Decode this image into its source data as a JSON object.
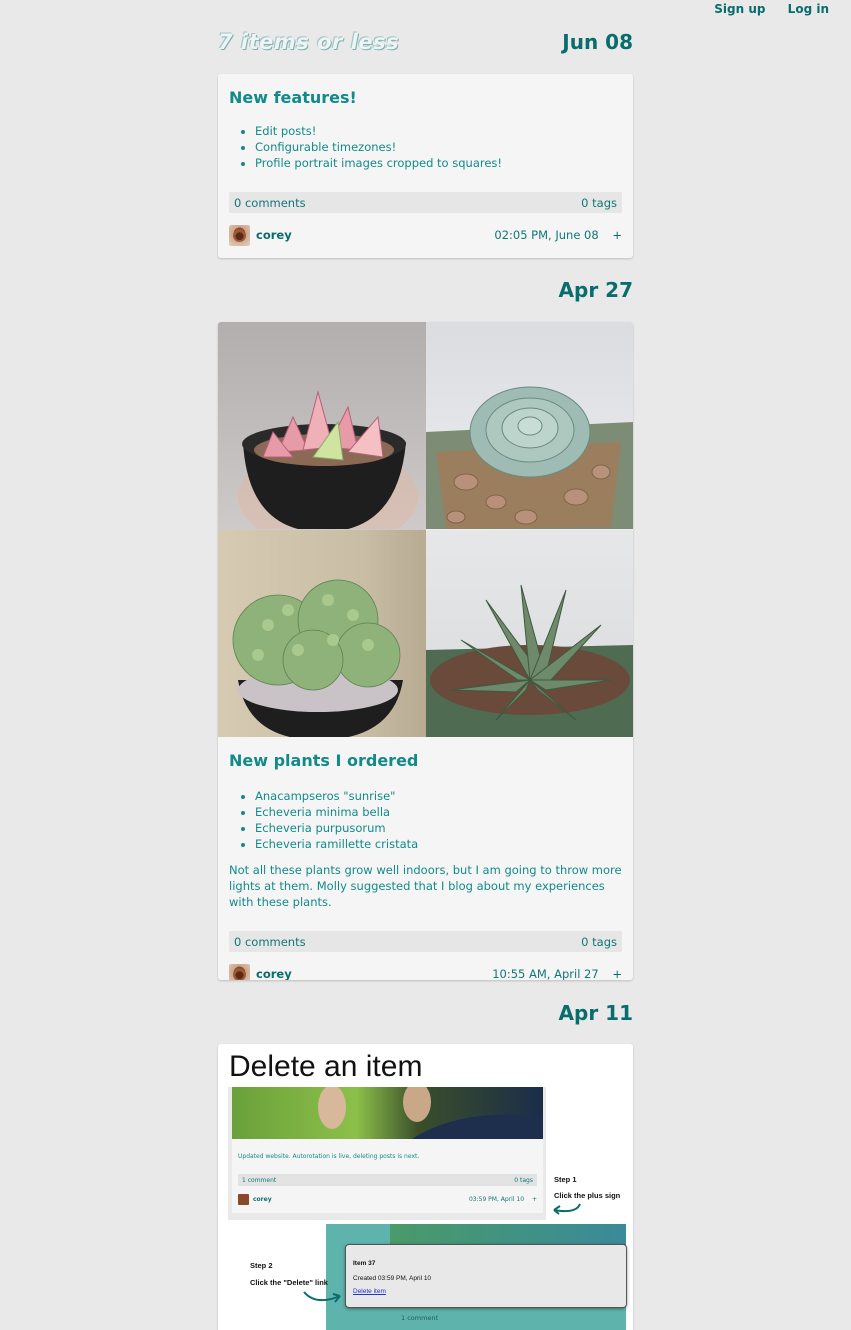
{
  "nav": {
    "signup": "Sign up",
    "login": "Log in"
  },
  "site": {
    "title": "7 items or less"
  },
  "posts": [
    {
      "date": "Jun 08",
      "title": "New features!",
      "bullets": [
        "Edit posts!",
        "Configurable timezones!",
        "Profile portrait images cropped to squares!"
      ],
      "comments": "0 comments",
      "tags": "0 tags",
      "author": "corey",
      "timestamp": "02:05 PM, June 08",
      "plus": "+"
    },
    {
      "date": "Apr 27",
      "title": "New plants I ordered",
      "bullets": [
        "Anacampseros \"sunrise\"",
        "Echeveria minima bella",
        "Echeveria purpusorum",
        "Echeveria ramillette cristata"
      ],
      "body": "Not all these plants grow well indoors, but I am going to throw more lights at them. Molly suggested that I blog about my experiences with these plants.",
      "comments": "0 comments",
      "tags": "0 tags",
      "author": "corey",
      "timestamp": "10:55 AM, April 27",
      "plus": "+"
    },
    {
      "date": "Apr 11",
      "tutorial": {
        "heading": "Delete an item",
        "inner_post_text": "Updated website. Autorotation is live, deleting posts is next.",
        "inner_comments": "1 comment",
        "inner_tags": "0 tags",
        "inner_author": "corey",
        "inner_timestamp": "03:59 PM, April 10",
        "inner_plus": "+",
        "step1_title": "Step 1",
        "step1_text": "Click the plus sign",
        "step2_title": "Step 2",
        "step2_text": "Click the \"Delete\" link",
        "popup_title": "Item 37",
        "popup_created": "Created 03:59 PM, April 10",
        "popup_link": "Delete item",
        "popup_comments": "1 comment"
      }
    }
  ],
  "colors": {
    "accent": "#0a6d6d",
    "link": "#138a8a",
    "page_bg": "#e9e9e9",
    "card_bg": "#f5f5f5"
  }
}
